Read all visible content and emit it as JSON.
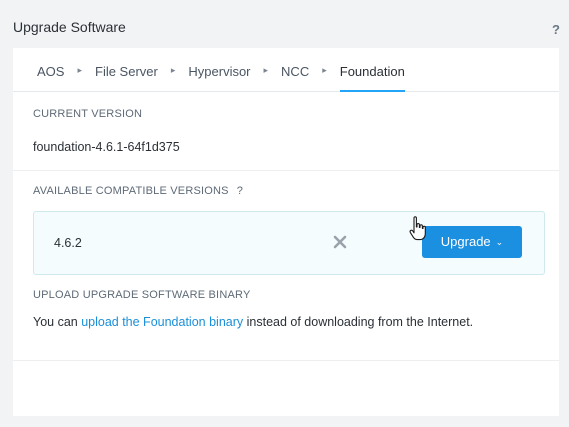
{
  "dialog": {
    "title": "Upgrade Software",
    "help_icon": "question-mark-icon",
    "help_glyph": "?"
  },
  "tabs": [
    {
      "label": "AOS",
      "active": false
    },
    {
      "label": "File Server",
      "active": false
    },
    {
      "label": "Hypervisor",
      "active": false
    },
    {
      "label": "NCC",
      "active": false
    },
    {
      "label": "Foundation",
      "active": true
    }
  ],
  "tab_separator": "▸",
  "current_version": {
    "label": "CURRENT VERSION",
    "value": "foundation-4.6.1-64f1d375"
  },
  "available": {
    "label": "AVAILABLE COMPATIBLE VERSIONS",
    "help_glyph": "?",
    "versions": [
      {
        "version": "4.6.2",
        "button_label": "Upgrade",
        "button_chevron": "⌄"
      }
    ]
  },
  "upload": {
    "label": "UPLOAD UPGRADE SOFTWARE BINARY",
    "text_before": "You can ",
    "link_text": "upload the Foundation binary",
    "text_after": " instead of downloading from the Internet."
  },
  "colors": {
    "accent": "#22a5f7",
    "button": "#1b8fe0",
    "link": "#1a8fd8"
  }
}
